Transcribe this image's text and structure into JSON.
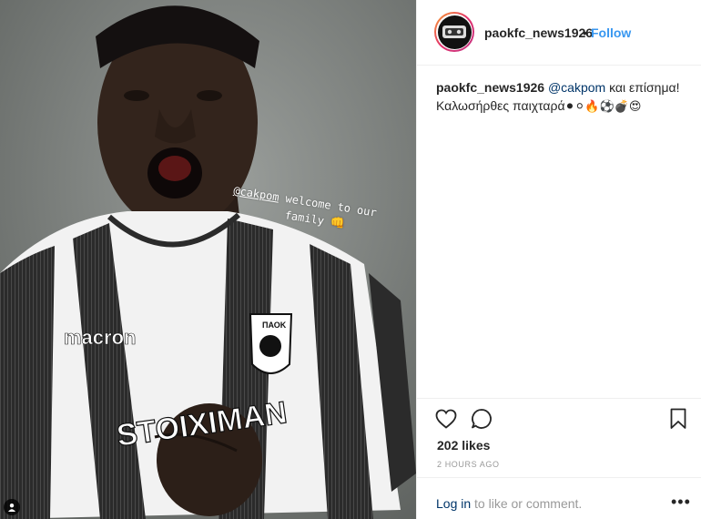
{
  "post": {
    "image_overlay": {
      "mention": "@cakpom",
      "text_line1": " welcome to our",
      "text_line2": "family",
      "emoji": "👊"
    },
    "jersey": {
      "sponsor": "macron",
      "crest": "ΠΑΟΚ",
      "chest": "STOIXIMAN"
    }
  },
  "header": {
    "username": "paokfc_news1926",
    "separator": "•",
    "follow_label": "Follow"
  },
  "caption": {
    "username": "paokfc_news1926",
    "mention": "@cakpom",
    "text1": " και επίσημα!",
    "text2": "Καλωσήρθες παιχταρά",
    "emojis": "⚫⚪🔥⚽💣😍"
  },
  "actions": {
    "like_icon": "heart-icon",
    "comment_icon": "comment-icon",
    "save_icon": "bookmark-icon"
  },
  "likes_text": "202 likes",
  "timestamp": "2 HOURS AGO",
  "comment_bar": {
    "login_link": "Log in",
    "login_suffix": " to like or comment.",
    "more_label": "•••"
  },
  "colors": {
    "link_blue": "#3897f0",
    "mention_blue": "#003569",
    "muted": "#999999",
    "border": "#efefef"
  }
}
